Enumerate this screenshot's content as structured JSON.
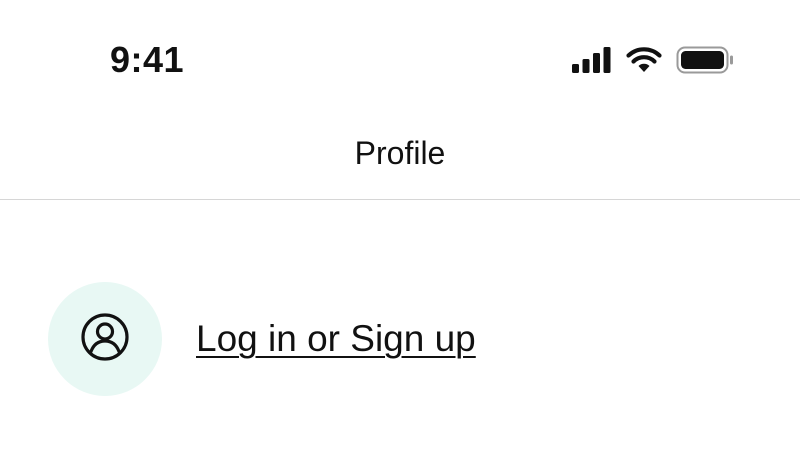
{
  "status_bar": {
    "time": "9:41",
    "icons": [
      "cellular-signal-icon",
      "wifi-icon",
      "battery-icon"
    ]
  },
  "header": {
    "title": "Profile"
  },
  "login": {
    "avatar_icon": "user-circle-icon",
    "link_label": "Log in or Sign up"
  },
  "colors": {
    "text": "#111111",
    "avatar_bg": "#e8f8f4",
    "divider": "#d6d6d6",
    "background": "#ffffff"
  }
}
